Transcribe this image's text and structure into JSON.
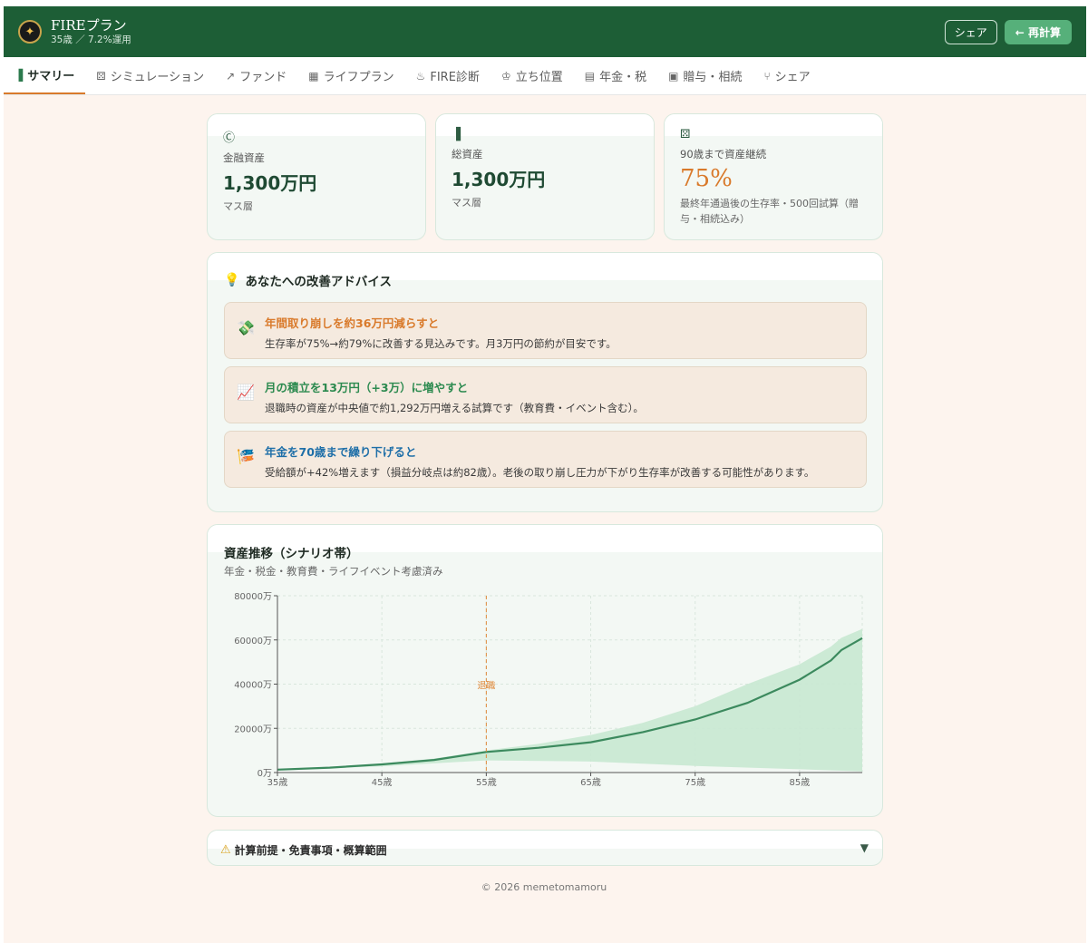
{
  "app": {
    "logo_icon": "compass-icon",
    "title": "FIREプラン",
    "subtitle": "35歳 ／ 7.2%運用",
    "share_label": "シェア",
    "recalc_label": "← 再計算"
  },
  "tabs": [
    {
      "label": "サマリー",
      "icon": "bar-chart-icon",
      "glyph": "▐",
      "active": true
    },
    {
      "label": "シミュレーション",
      "icon": "dice-icon",
      "glyph": "⚄",
      "active": false
    },
    {
      "label": "ファンド",
      "icon": "trend-up-icon",
      "glyph": "↗",
      "active": false
    },
    {
      "label": "ライフプラン",
      "icon": "calendar-icon",
      "glyph": "▦",
      "active": false
    },
    {
      "label": "FIRE診断",
      "icon": "flame-icon",
      "glyph": "♨",
      "active": false
    },
    {
      "label": "立ち位置",
      "icon": "trophy-icon",
      "glyph": "♔",
      "active": false
    },
    {
      "label": "年金・税",
      "icon": "bank-icon",
      "glyph": "▤",
      "active": false
    },
    {
      "label": "贈与・相続",
      "icon": "gift-icon",
      "glyph": "▣",
      "active": false
    },
    {
      "label": "シェア",
      "icon": "share-icon",
      "glyph": "⑂",
      "active": false
    }
  ],
  "kpis": [
    {
      "icon": "coin-icon",
      "glyph": "Ⓒ",
      "label": "金融資産",
      "value": "1,300万円",
      "note": "マス層"
    },
    {
      "icon": "bar-chart-icon",
      "glyph": "▐",
      "label": "総資産",
      "value": "1,300万円",
      "note": "マス層"
    },
    {
      "icon": "dice-icon",
      "glyph": "⚄",
      "label": "90歳まで資産継続",
      "value": "75%",
      "note": "最終年通過後の生存率・500回試算（贈与・相続込み）"
    }
  ],
  "advice": {
    "icon": "lightbulb-icon",
    "glyph": "💡",
    "title": "あなたへの改善アドバイス",
    "items": [
      {
        "icon": "money-wings-icon",
        "glyph": "💸",
        "headline": "年間取り崩しを約36万円減らすと",
        "body": "生存率が75%→約79%に改善する見込みです。月3万円の節約が目安です。",
        "color": "#d97a2b"
      },
      {
        "icon": "chart-up-icon",
        "glyph": "📈",
        "headline": "月の積立を13万円（+3万）に増やすと",
        "body": "退職時の資産が中央値で約1,292万円増える試算です（教育費・イベント含む）。",
        "color": "#2c8a4f"
      },
      {
        "icon": "pinwheel-icon",
        "glyph": "🎏",
        "headline": "年金を70歳まで繰り下げると",
        "body": "受給額が+42%増えます（損益分岐点は約82歳）。老後の取り崩し圧力が下がり生存率が改善する可能性があります。",
        "color": "#1f6fa8"
      }
    ]
  },
  "chart_section": {
    "title": "資産推移（シナリオ帯）",
    "subtitle": "年金・税金・教育費・ライフイベント考慮済み"
  },
  "chart_data": {
    "type": "area",
    "title": "資産推移（シナリオ帯）",
    "xlabel": "",
    "ylabel": "",
    "x_ticks": [
      "35歳",
      "45歳",
      "55歳",
      "65歳",
      "75歳",
      "85歳"
    ],
    "y_ticks": [
      "0万",
      "20000万",
      "40000万",
      "60000万",
      "80000万"
    ],
    "xlim": [
      35,
      91
    ],
    "ylim": [
      0,
      80000
    ],
    "annotation": {
      "x": 55,
      "label": "退職"
    },
    "series": [
      {
        "role": "median",
        "x": [
          35,
          40,
          45,
          50,
          55,
          60,
          65,
          70,
          75,
          80,
          85,
          88,
          89,
          91
        ],
        "values": [
          1300,
          2200,
          3700,
          5700,
          9300,
          11200,
          13700,
          18300,
          24000,
          31500,
          42000,
          50700,
          55400,
          60800
        ]
      },
      {
        "role": "upper",
        "x": [
          35,
          40,
          45,
          50,
          55,
          60,
          65,
          70,
          75,
          80,
          85,
          88,
          89,
          91
        ],
        "values": [
          1400,
          2400,
          4100,
          6300,
          10000,
          13000,
          17000,
          22500,
          30000,
          40000,
          49000,
          57000,
          61000,
          65000
        ]
      },
      {
        "role": "lower",
        "x": [
          35,
          45,
          55,
          65,
          75,
          85,
          91
        ],
        "values": [
          1200,
          2800,
          5500,
          5000,
          3000,
          1500,
          500
        ]
      }
    ],
    "colors": {
      "band": "#c8e8d2",
      "median": "#3c8a5e",
      "retire": "#e08a3c"
    },
    "grid": true
  },
  "disclaimer": {
    "icon": "warning-icon",
    "glyph": "⚠",
    "label": "計算前提・免責事項・概算範囲",
    "toggle_icon": "chevron-down-icon",
    "toggle_glyph": "▼"
  },
  "footer": "© 2026 memetomamoru"
}
